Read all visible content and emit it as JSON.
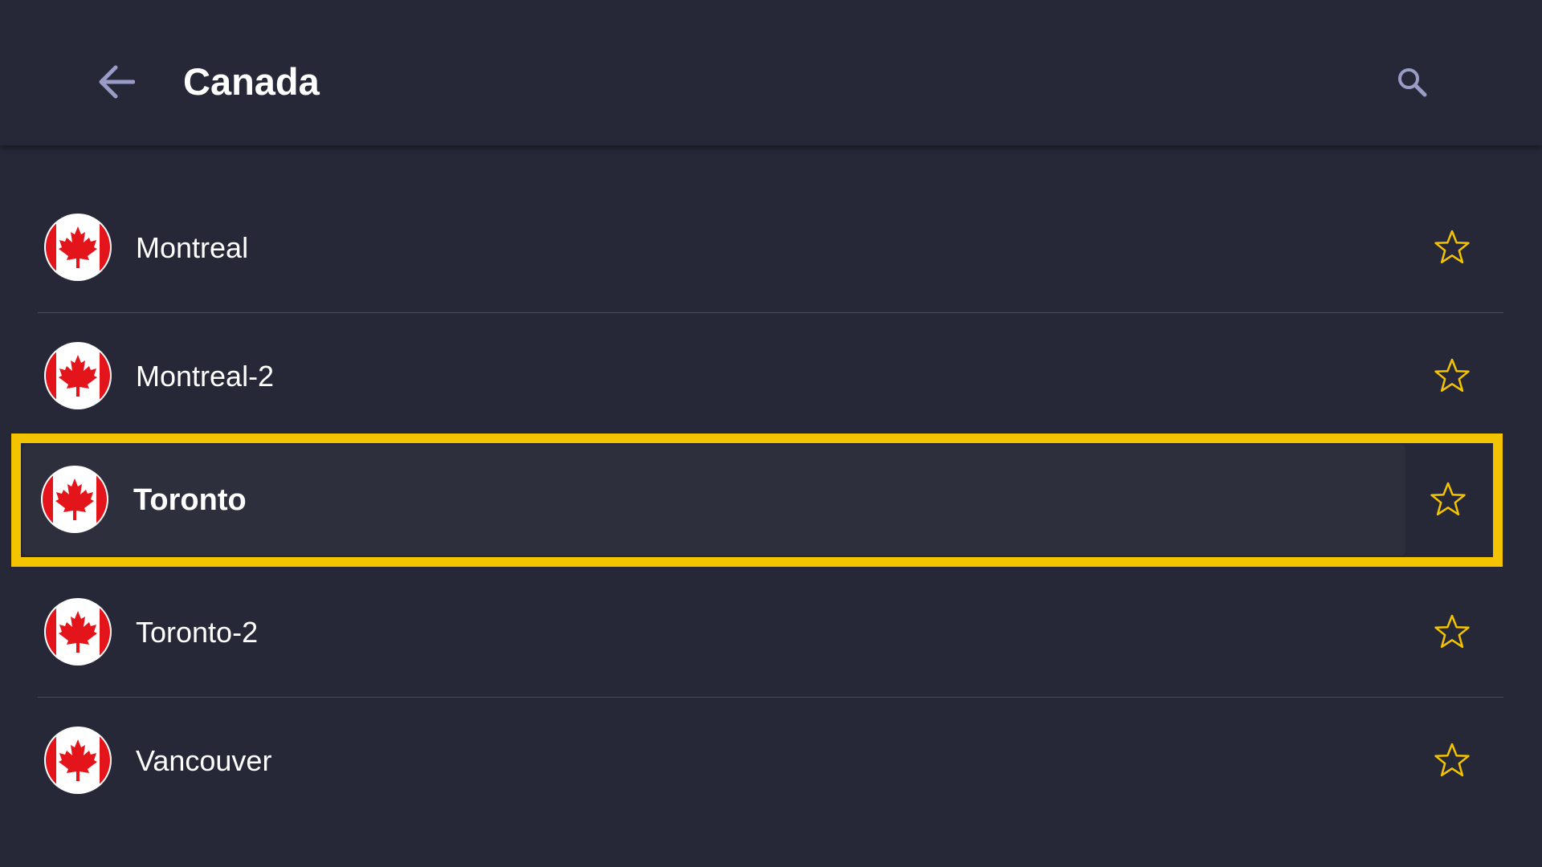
{
  "header": {
    "title": "Canada",
    "back_icon": "arrow-left-icon",
    "search_icon": "search-icon"
  },
  "servers": [
    {
      "name": "Montreal",
      "flag": "canada-flag-icon",
      "favorite": false,
      "selected": false
    },
    {
      "name": "Montreal-2",
      "flag": "canada-flag-icon",
      "favorite": false,
      "selected": false
    },
    {
      "name": "Toronto",
      "flag": "canada-flag-icon",
      "favorite": false,
      "selected": true
    },
    {
      "name": "Toronto-2",
      "flag": "canada-flag-icon",
      "favorite": false,
      "selected": false
    },
    {
      "name": "Vancouver",
      "flag": "canada-flag-icon",
      "favorite": false,
      "selected": false
    }
  ],
  "colors": {
    "background": "#262837",
    "focus_border": "#f5c400",
    "star": "#f5c400",
    "icon": "#9a9cc8",
    "flag_red": "#e3151b"
  }
}
